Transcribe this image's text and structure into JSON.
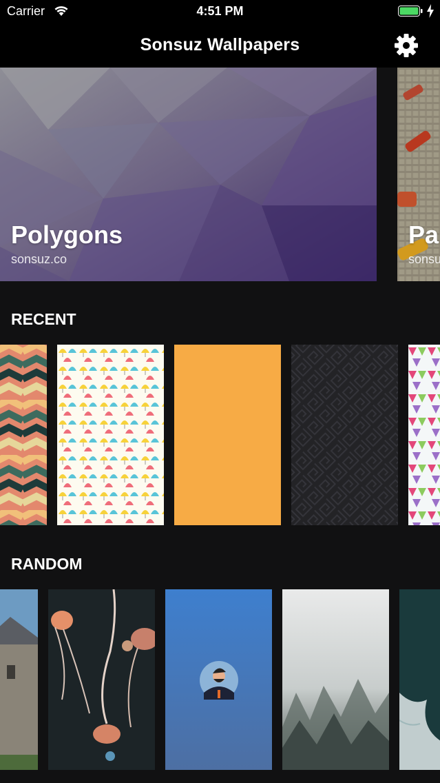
{
  "status_bar": {
    "carrier": "Carrier",
    "time": "4:51 PM"
  },
  "nav": {
    "title": "Sonsuz Wallpapers",
    "settings_icon": "gear-icon"
  },
  "featured": [
    {
      "title": "Polygons",
      "subtitle": "sonsuz.co"
    },
    {
      "title": "Pa",
      "subtitle": "sonsu"
    }
  ],
  "sections": {
    "recent": {
      "title": "RECENT"
    },
    "random": {
      "title": "RANDOM"
    }
  },
  "colors": {
    "background": "#111112",
    "bar": "#000000",
    "battery": "#4cd964",
    "orange": "#f7a941"
  }
}
